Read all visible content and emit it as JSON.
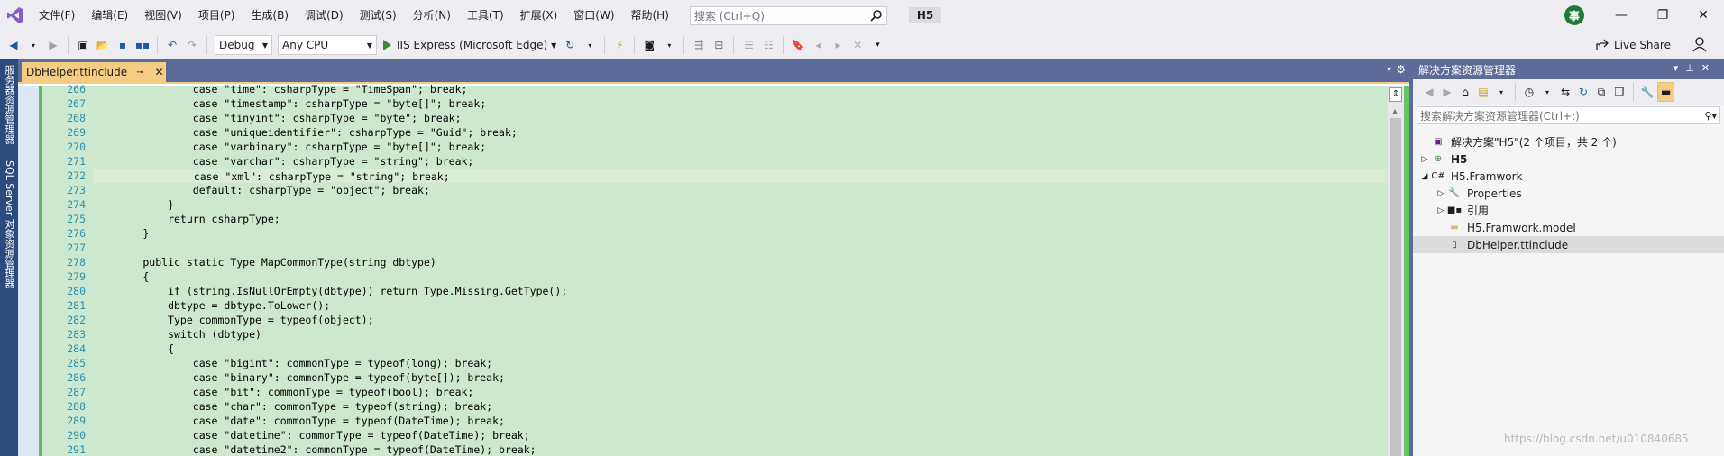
{
  "menubar": {
    "items": [
      "文件(F)",
      "编辑(E)",
      "视图(V)",
      "项目(P)",
      "生成(B)",
      "调试(D)",
      "测试(S)",
      "分析(N)",
      "工具(T)",
      "扩展(X)",
      "窗口(W)",
      "帮助(H)"
    ],
    "search_placeholder": "搜索 (Ctrl+Q)",
    "solution_badge": "H5",
    "avatar_text": "事"
  },
  "toolbar": {
    "config": "Debug",
    "platform": "Any CPU",
    "run_target": "IIS Express (Microsoft Edge)",
    "live_share": "Live Share"
  },
  "side_strip": {
    "server_explorer": "服务器资源管理器",
    "sql_explorer": "SQL Server 对象资源管理器"
  },
  "editor": {
    "tab_title": "DbHelper.ttinclude",
    "lines": [
      {
        "n": "266",
        "t": "                case \"time\": csharpType = \"TimeSpan\"; break;"
      },
      {
        "n": "267",
        "t": "                case \"timestamp\": csharpType = \"byte[]\"; break;"
      },
      {
        "n": "268",
        "t": "                case \"tinyint\": csharpType = \"byte\"; break;"
      },
      {
        "n": "269",
        "t": "                case \"uniqueidentifier\": csharpType = \"Guid\"; break;"
      },
      {
        "n": "270",
        "t": "                case \"varbinary\": csharpType = \"byte[]\"; break;"
      },
      {
        "n": "271",
        "t": "                case \"varchar\": csharpType = \"string\"; break;"
      },
      {
        "n": "272",
        "t": "                case \"xml\": csharpType = \"string\"; break;"
      },
      {
        "n": "273",
        "t": "                default: csharpType = \"object\"; break;"
      },
      {
        "n": "274",
        "t": "            }"
      },
      {
        "n": "275",
        "t": "            return csharpType;"
      },
      {
        "n": "276",
        "t": "        }"
      },
      {
        "n": "277",
        "t": ""
      },
      {
        "n": "278",
        "t": "        public static Type MapCommonType(string dbtype)"
      },
      {
        "n": "279",
        "t": "        {"
      },
      {
        "n": "280",
        "t": "            if (string.IsNullOrEmpty(dbtype)) return Type.Missing.GetType();"
      },
      {
        "n": "281",
        "t": "            dbtype = dbtype.ToLower();"
      },
      {
        "n": "282",
        "t": "            Type commonType = typeof(object);"
      },
      {
        "n": "283",
        "t": "            switch (dbtype)"
      },
      {
        "n": "284",
        "t": "            {"
      },
      {
        "n": "285",
        "t": "                case \"bigint\": commonType = typeof(long); break;"
      },
      {
        "n": "286",
        "t": "                case \"binary\": commonType = typeof(byte[]); break;"
      },
      {
        "n": "287",
        "t": "                case \"bit\": commonType = typeof(bool); break;"
      },
      {
        "n": "288",
        "t": "                case \"char\": commonType = typeof(string); break;"
      },
      {
        "n": "289",
        "t": "                case \"date\": commonType = typeof(DateTime); break;"
      },
      {
        "n": "290",
        "t": "                case \"datetime\": commonType = typeof(DateTime); break;"
      },
      {
        "n": "291",
        "t": "                case \"datetime2\": commonType = typeof(DateTime); break;"
      }
    ],
    "current_line": "272"
  },
  "solution_explorer": {
    "title": "解决方案资源管理器",
    "search_placeholder": "搜索解决方案资源管理器(Ctrl+;)",
    "tree": [
      {
        "label": "解决方案\"H5\"(2 个项目，共 2 个)",
        "level": 0,
        "arrow": "",
        "icon": "solution-icon"
      },
      {
        "label": "H5",
        "level": 0,
        "arrow": "▷",
        "icon": "web-project-icon",
        "bold": true
      },
      {
        "label": "H5.Framwork",
        "level": 0,
        "arrow": "◢",
        "icon": "csharp-project-icon"
      },
      {
        "label": "Properties",
        "level": 1,
        "arrow": "▷",
        "icon": "wrench-icon"
      },
      {
        "label": "引用",
        "level": 1,
        "arrow": "▷",
        "icon": "references-icon"
      },
      {
        "label": "H5.Framwork.model",
        "level": 1,
        "arrow": "",
        "icon": "folder-icon"
      },
      {
        "label": "DbHelper.ttinclude",
        "level": 1,
        "arrow": "",
        "icon": "file-icon",
        "selected": true
      }
    ]
  },
  "watermark": "https://blog.csdn.net/u010840685"
}
